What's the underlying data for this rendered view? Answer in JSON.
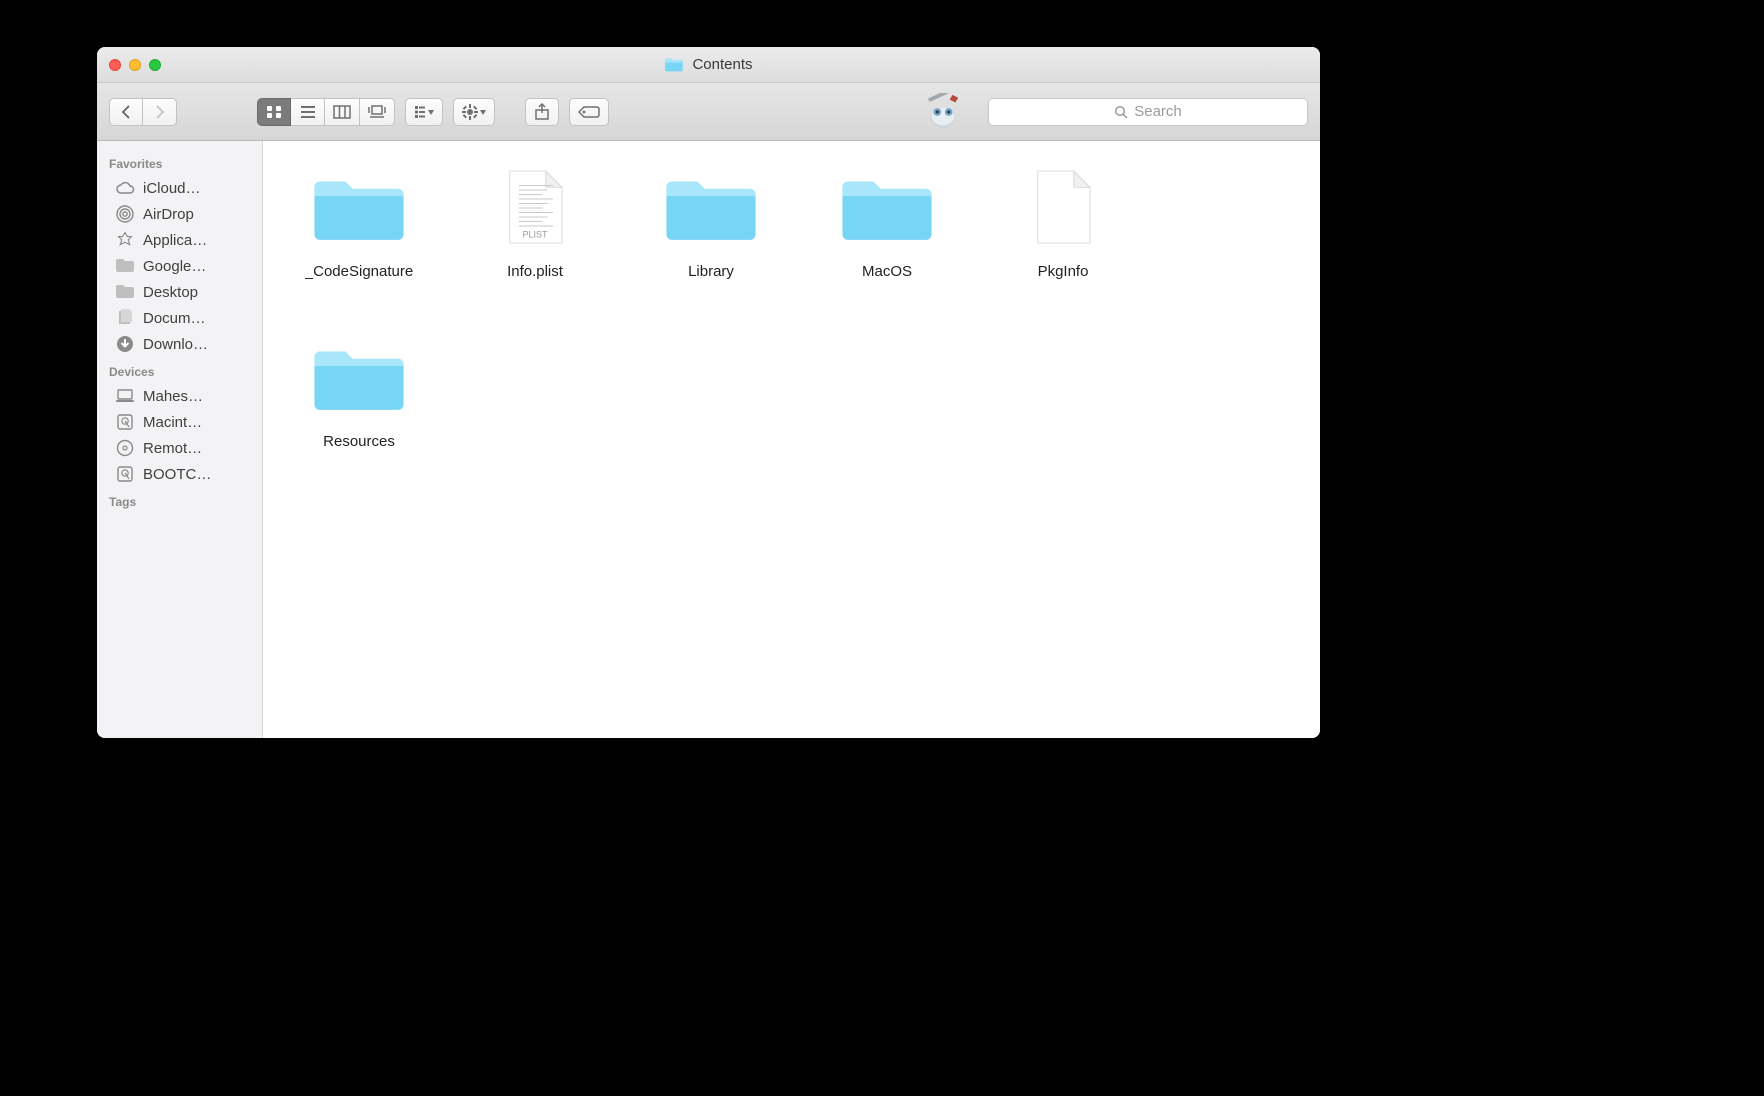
{
  "window": {
    "title": "Contents"
  },
  "search": {
    "placeholder": "Search"
  },
  "sidebar": {
    "sections": [
      {
        "title": "Favorites",
        "items": [
          {
            "icon": "cloud",
            "label": "iCloud…"
          },
          {
            "icon": "airdrop",
            "label": "AirDrop"
          },
          {
            "icon": "apps",
            "label": "Applica…"
          },
          {
            "icon": "folder-g",
            "label": "Google…"
          },
          {
            "icon": "folder-g",
            "label": "Desktop"
          },
          {
            "icon": "docs",
            "label": "Docum…"
          },
          {
            "icon": "download",
            "label": "Downlo…"
          }
        ]
      },
      {
        "title": "Devices",
        "items": [
          {
            "icon": "laptop",
            "label": "Mahes…"
          },
          {
            "icon": "hdd",
            "label": "Macint…"
          },
          {
            "icon": "optical",
            "label": "Remot…"
          },
          {
            "icon": "hdd",
            "label": "BOOTC…"
          }
        ]
      },
      {
        "title": "Tags",
        "items": []
      }
    ]
  },
  "items": [
    {
      "type": "folder",
      "name": "_CodeSignature"
    },
    {
      "type": "plist",
      "name": "Info.plist",
      "badge": "PLIST"
    },
    {
      "type": "folder",
      "name": "Library"
    },
    {
      "type": "folder",
      "name": "MacOS"
    },
    {
      "type": "file",
      "name": "PkgInfo"
    },
    {
      "type": "folder",
      "name": "Resources"
    }
  ]
}
